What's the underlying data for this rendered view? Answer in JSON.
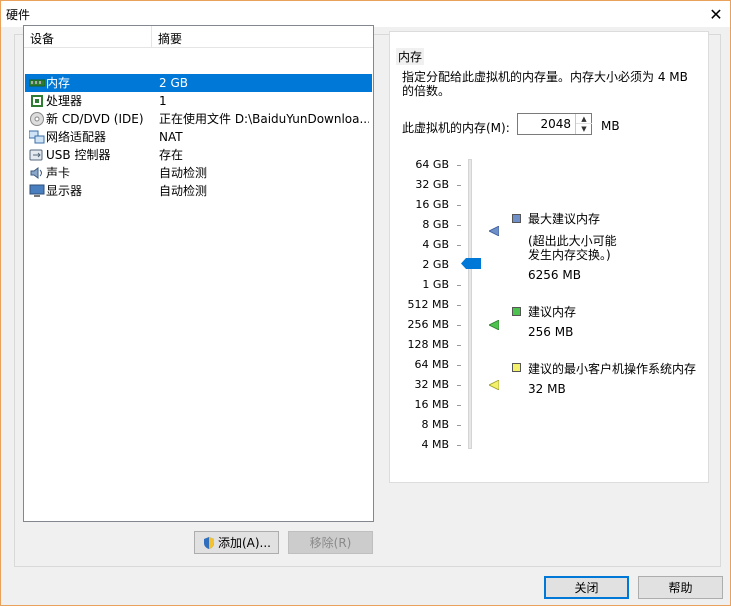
{
  "window": {
    "title": "硬件"
  },
  "device_list": {
    "columns": [
      "设备",
      "摘要"
    ],
    "rows": [
      {
        "icon": "memory-icon",
        "name": "内存",
        "summary": "2 GB",
        "selected": true
      },
      {
        "icon": "processor-icon",
        "name": "处理器",
        "summary": "1",
        "selected": false
      },
      {
        "icon": "cd-dvd-icon",
        "name": "新 CD/DVD (IDE)",
        "summary": "正在使用文件 D:\\BaiduYunDownloa...",
        "selected": false
      },
      {
        "icon": "network-adapter-icon",
        "name": "网络适配器",
        "summary": "NAT",
        "selected": false
      },
      {
        "icon": "usb-icon",
        "name": "USB 控制器",
        "summary": "存在",
        "selected": false
      },
      {
        "icon": "sound-card-icon",
        "name": "声卡",
        "summary": "自动检测",
        "selected": false
      },
      {
        "icon": "display-icon",
        "name": "显示器",
        "summary": "自动检测",
        "selected": false
      }
    ]
  },
  "buttons": {
    "add": "添加(A)...",
    "remove": "移除(R)",
    "close": "关闭",
    "help": "帮助"
  },
  "memory": {
    "group_title": "内存",
    "description": "指定分配给此虚拟机的内存量。内存大小必须为 4 MB 的倍数。",
    "field_label": "此虚拟机的内存(M):",
    "value": "2048",
    "unit": "MB",
    "scale_labels": [
      "64 GB",
      "32 GB",
      "16 GB",
      "8 GB",
      "4 GB",
      "2 GB",
      "1 GB",
      "512 MB",
      "256 MB",
      "128 MB",
      "64 MB",
      "32 MB",
      "16 MB",
      "8 MB",
      "4 MB"
    ],
    "legend": {
      "max_title": "最大建议内存",
      "max_note_1": "(超出此大小可能",
      "max_note_2": "发生内存交换。)",
      "max_value": "6256 MB",
      "rec_title": "建议内存",
      "rec_value": "256 MB",
      "min_title": "建议的最小客户机操作系统内存",
      "min_value": "32 MB"
    },
    "colors": {
      "max": "#6f8fc9",
      "recommended": "#4ec24e",
      "minimum": "#f3f06a",
      "thumb": "#0078d7"
    }
  }
}
